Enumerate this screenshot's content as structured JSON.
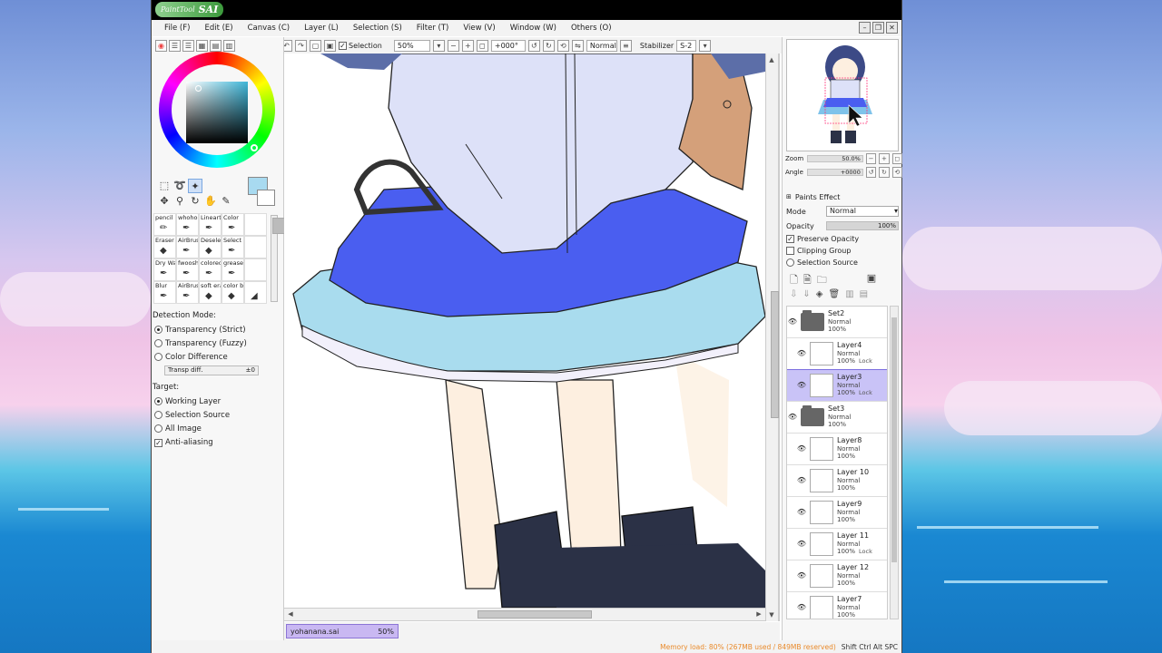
{
  "app": {
    "name": "SAI",
    "name_prefix": "PaintTool"
  },
  "menu": [
    "File (F)",
    "Edit (E)",
    "Canvas (C)",
    "Layer (L)",
    "Selection (S)",
    "Filter (T)",
    "View (V)",
    "Window (W)",
    "Others (O)"
  ],
  "toolbar": {
    "selection_label": "Selection",
    "selection_checked": true,
    "zoom": "50%",
    "angle": "+000°",
    "blend_mode": "Normal",
    "stabilizer_label": "Stabilizer",
    "stabilizer_value": "S-2"
  },
  "color": {
    "main": "#a8daf0",
    "sub": "#ffffff"
  },
  "brushes": [
    "pencil",
    "whoho",
    "Lineart",
    "Color",
    "",
    "Eraser",
    "AirBrush",
    "Deselect",
    "Select",
    "",
    "Dry Wat",
    "fwoosh",
    "colored",
    "grease",
    "",
    "Blur",
    "AirBrush",
    "soft eras",
    "color b",
    ""
  ],
  "detection": {
    "title": "Detection Mode:",
    "options": [
      "Transparency (Strict)",
      "Transparency (Fuzzy)",
      "Color Difference"
    ],
    "selected": 0,
    "transp_label": "Transp diff.",
    "transp_value": "±0"
  },
  "target": {
    "title": "Target:",
    "options": [
      "Working Layer",
      "Selection Source",
      "All Image"
    ],
    "selected": 0
  },
  "antialiasing": {
    "label": "Anti-aliasing",
    "checked": true
  },
  "navigator": {
    "zoom_label": "Zoom",
    "zoom_value": "50.0%",
    "angle_label": "Angle",
    "angle_value": "+0000"
  },
  "layer_props": {
    "paints_effect": "Paints Effect",
    "mode_label": "Mode",
    "mode_value": "Normal",
    "opacity_label": "Opacity",
    "opacity_value": "100%",
    "preserve_opacity": "Preserve Opacity",
    "clipping_group": "Clipping Group",
    "selection_source": "Selection Source"
  },
  "layers": [
    {
      "name": "Set2",
      "mode": "Normal",
      "opacity": "100%",
      "folder": true,
      "child": false,
      "selected": false,
      "lock": ""
    },
    {
      "name": "Layer4",
      "mode": "Normal",
      "opacity": "100%",
      "folder": false,
      "child": true,
      "selected": false,
      "lock": "Lock"
    },
    {
      "name": "Layer3",
      "mode": "Normal",
      "opacity": "100%",
      "folder": false,
      "child": true,
      "selected": true,
      "lock": "Lock"
    },
    {
      "name": "Set3",
      "mode": "Normal",
      "opacity": "100%",
      "folder": true,
      "child": false,
      "selected": false,
      "lock": ""
    },
    {
      "name": "Layer8",
      "mode": "Normal",
      "opacity": "100%",
      "folder": false,
      "child": true,
      "selected": false,
      "lock": ""
    },
    {
      "name": "Layer 10",
      "mode": "Normal",
      "opacity": "100%",
      "folder": false,
      "child": true,
      "selected": false,
      "lock": ""
    },
    {
      "name": "Layer9",
      "mode": "Normal",
      "opacity": "100%",
      "folder": false,
      "child": true,
      "selected": false,
      "lock": ""
    },
    {
      "name": "Layer 11",
      "mode": "Normal",
      "opacity": "100%",
      "folder": false,
      "child": true,
      "selected": false,
      "lock": "Lock"
    },
    {
      "name": "Layer 12",
      "mode": "Normal",
      "opacity": "100%",
      "folder": false,
      "child": true,
      "selected": false,
      "lock": ""
    },
    {
      "name": "Layer7",
      "mode": "Normal",
      "opacity": "100%",
      "folder": false,
      "child": true,
      "selected": false,
      "lock": ""
    }
  ],
  "document": {
    "tab_name": "yohanana.sai",
    "tab_zoom": "50%"
  },
  "status": {
    "memory": "Memory load: 80% (267MB used / 849MB reserved)",
    "keys": "Shift Ctrl Alt SPC"
  },
  "palette": {
    "skirt_dark": "#4a5ef0",
    "skirt_light": "#a9dcee",
    "shirt": "#dde1f8",
    "skin": "#fdefe0",
    "socks": "#2b3146",
    "bag": "#d4a07a"
  }
}
